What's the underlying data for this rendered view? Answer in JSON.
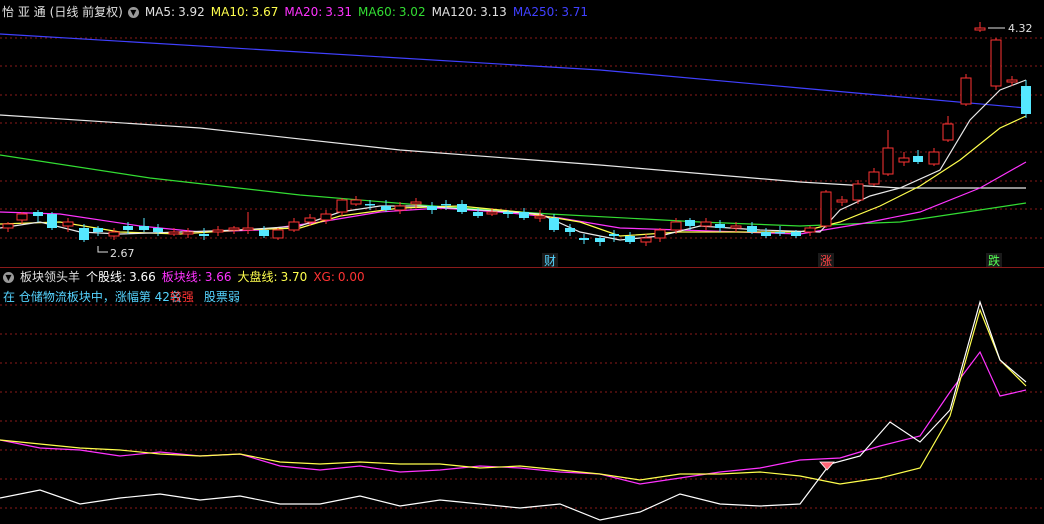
{
  "main": {
    "stock_name": "怡 亚 通",
    "mode": "(日线 前复权)",
    "ma": [
      {
        "label": "MA5:",
        "value": "3.92",
        "color": "#e0e0e0"
      },
      {
        "label": "MA10:",
        "value": "3.67",
        "color": "#ffff4d"
      },
      {
        "label": "MA20:",
        "value": "3.31",
        "color": "#ff33ff"
      },
      {
        "label": "MA60:",
        "value": "3.02",
        "color": "#33dd33"
      },
      {
        "label": "MA120:",
        "value": "3.13",
        "color": "#e0e0e0"
      },
      {
        "label": "MA250:",
        "value": "3.71",
        "color": "#4040ff"
      }
    ],
    "high_label": "4.32",
    "low_label": "2.67",
    "markers": [
      {
        "text": "财",
        "bg": "#1a1a1a",
        "color": "#55d4ff"
      },
      {
        "text": "涨",
        "bg": "#1a1a1a",
        "color": "#ff4444"
      },
      {
        "text": "跌",
        "bg": "#1a1a1a",
        "color": "#55ff55"
      }
    ]
  },
  "indicator": {
    "name": "板块领头羊",
    "items": [
      {
        "label": "个股线:",
        "value": "3.66",
        "color": "#ffffff"
      },
      {
        "label": "板块线:",
        "value": "3.66",
        "color": "#ff33ff"
      },
      {
        "label": "大盘线:",
        "value": "3.70",
        "color": "#ffff4d"
      },
      {
        "label": "XG:",
        "value": "0.00",
        "color": "#ff3333"
      }
    ],
    "desc_prefix": "在 仓储物流板块中，涨幅第 42名",
    "desc_strength": "较强",
    "desc_suffix": "股票弱"
  },
  "colors": {
    "up": "#ff3333",
    "down": "#55e8ff",
    "grid": "#8a1a1a"
  }
}
